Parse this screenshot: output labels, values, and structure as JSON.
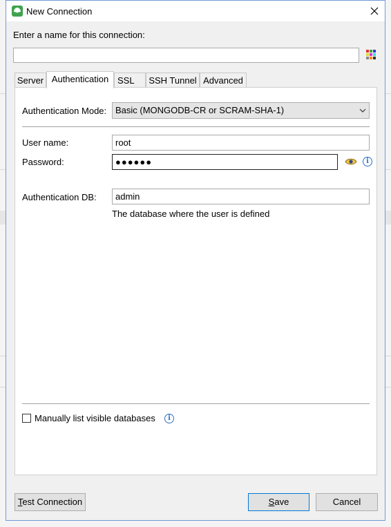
{
  "window": {
    "title": "New Connection"
  },
  "icons": {
    "app": "mongo-leaf-icon",
    "close": "close-icon",
    "color": "color-palette-icon",
    "eye": "eye-icon",
    "info": "info-icon"
  },
  "connection_name": {
    "label": "Enter a name for this connection:",
    "value": ""
  },
  "tabs": [
    {
      "label": "Server",
      "active": false
    },
    {
      "label": "Authentication",
      "active": true
    },
    {
      "label": "SSL",
      "active": false
    },
    {
      "label": "SSH Tunnel",
      "active": false
    },
    {
      "label": "Advanced",
      "active": false
    }
  ],
  "auth": {
    "mode_label": "Authentication Mode:",
    "mode_value": "Basic (MONGODB-CR or SCRAM-SHA-1)",
    "username_label": "User name:",
    "username_value": "root",
    "password_label": "Password:",
    "password_mask": "●●●●●●",
    "authdb_label": "Authentication DB:",
    "authdb_value": "admin",
    "authdb_hint": "The database where the user is defined",
    "manual_list_label": "Manually list visible databases",
    "manual_list_checked": false
  },
  "buttons": {
    "test_prefix": "T",
    "test_rest": "est Connection",
    "save_prefix": "S",
    "save_rest": "ave",
    "cancel": "Cancel"
  },
  "colors": {
    "accent": "#0078d7",
    "info": "#2d6fc4",
    "app_icon": "#3fa34d"
  }
}
